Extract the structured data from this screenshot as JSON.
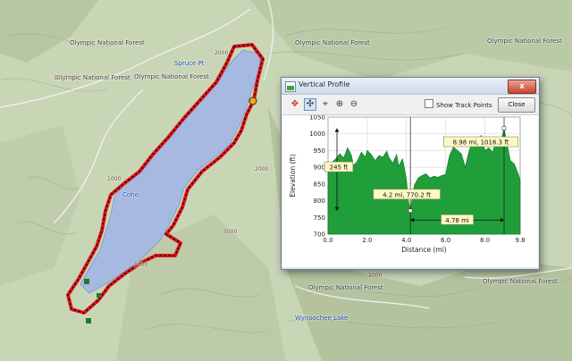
{
  "map": {
    "labels": [
      {
        "text": "Olympic National Forest",
        "cls": ""
      },
      {
        "text": "Olympic National Forest",
        "cls": ""
      },
      {
        "text": "Olympic National Forest",
        "cls": ""
      },
      {
        "text": "Olympic National Forest",
        "cls": ""
      },
      {
        "text": "Olympic National Forest",
        "cls": ""
      },
      {
        "text": "Olympic National Forest",
        "cls": ""
      },
      {
        "text": "Olympic National Forest",
        "cls": ""
      },
      {
        "text": "Wynoochee Lake",
        "cls": "blue"
      },
      {
        "text": "Spruce Pt",
        "cls": "blue"
      },
      {
        "text": "Coho",
        "cls": "blue"
      },
      {
        "text": "2000",
        "cls": "elev"
      },
      {
        "text": "3000",
        "cls": "elev"
      },
      {
        "text": "2000",
        "cls": "elev"
      },
      {
        "text": "1000",
        "cls": "elev"
      },
      {
        "text": "3000",
        "cls": "elev"
      },
      {
        "text": "2000",
        "cls": "elev"
      },
      {
        "text": "1000",
        "cls": "elev"
      }
    ],
    "colors": {
      "lake": "#a6b9e0",
      "land": "#c9d6b6",
      "track": "#e0141c",
      "track_dots": "#1a0d0d",
      "road": "#f3f3f3"
    }
  },
  "dialog": {
    "title": "Vertical Profile",
    "close_x_label": "x",
    "show_track_points_label": "Show Track Points",
    "close_label": "Close",
    "tools": [
      "add-point-icon",
      "pan-icon",
      "select-icon",
      "zoom-in-icon",
      "zoom-out-icon"
    ]
  },
  "chart_data": {
    "type": "area",
    "xlabel": "Distance   (mi)",
    "ylabel": "Elevation (ft)",
    "xlim": [
      0,
      9.8
    ],
    "ylim": [
      700,
      1050
    ],
    "x_ticks": [
      "0.0",
      "2.0",
      "4.0",
      "6.0",
      "8.0",
      "9.8"
    ],
    "x_tick_values": [
      0,
      2,
      4,
      6,
      8,
      9.8
    ],
    "y_ticks": [
      "700",
      "750",
      "800",
      "850",
      "900",
      "950",
      "1000",
      "1050"
    ],
    "y_tick_values": [
      700,
      750,
      800,
      850,
      900,
      950,
      1000,
      1050
    ],
    "grid": true,
    "fill_color": "#1f9e3a",
    "x": [
      0.0,
      0.2,
      0.4,
      0.6,
      0.8,
      1.0,
      1.2,
      1.3,
      1.5,
      1.7,
      1.9,
      2.0,
      2.2,
      2.4,
      2.6,
      2.8,
      3.0,
      3.1,
      3.3,
      3.5,
      3.6,
      3.8,
      3.9,
      4.0,
      4.1,
      4.2,
      4.4,
      4.6,
      4.8,
      5.0,
      5.2,
      5.4,
      5.6,
      5.8,
      6.0,
      6.2,
      6.4,
      6.6,
      6.8,
      7.0,
      7.2,
      7.4,
      7.6,
      7.8,
      8.0,
      8.2,
      8.4,
      8.6,
      8.8,
      8.98,
      9.1,
      9.3,
      9.5,
      9.7,
      9.8
    ],
    "y": [
      902,
      915,
      925,
      940,
      928,
      958,
      935,
      905,
      918,
      945,
      930,
      950,
      938,
      920,
      935,
      930,
      948,
      930,
      912,
      938,
      903,
      925,
      895,
      860,
      800,
      770.2,
      845,
      868,
      875,
      880,
      868,
      873,
      870,
      875,
      878,
      935,
      960,
      950,
      940,
      900,
      950,
      980,
      960,
      995,
      950,
      958,
      945,
      985,
      970,
      1016.3,
      980,
      920,
      910,
      880,
      860
    ],
    "annotations": [
      {
        "text": "245 ft"
      },
      {
        "text": "4.2 mi, 770.2 ft",
        "x": 4.2,
        "y": 770.2
      },
      {
        "text": "8.98 mi, 1016.3 ft",
        "x": 8.98,
        "y": 1016.3
      },
      {
        "text": "4.78 mi"
      }
    ]
  }
}
